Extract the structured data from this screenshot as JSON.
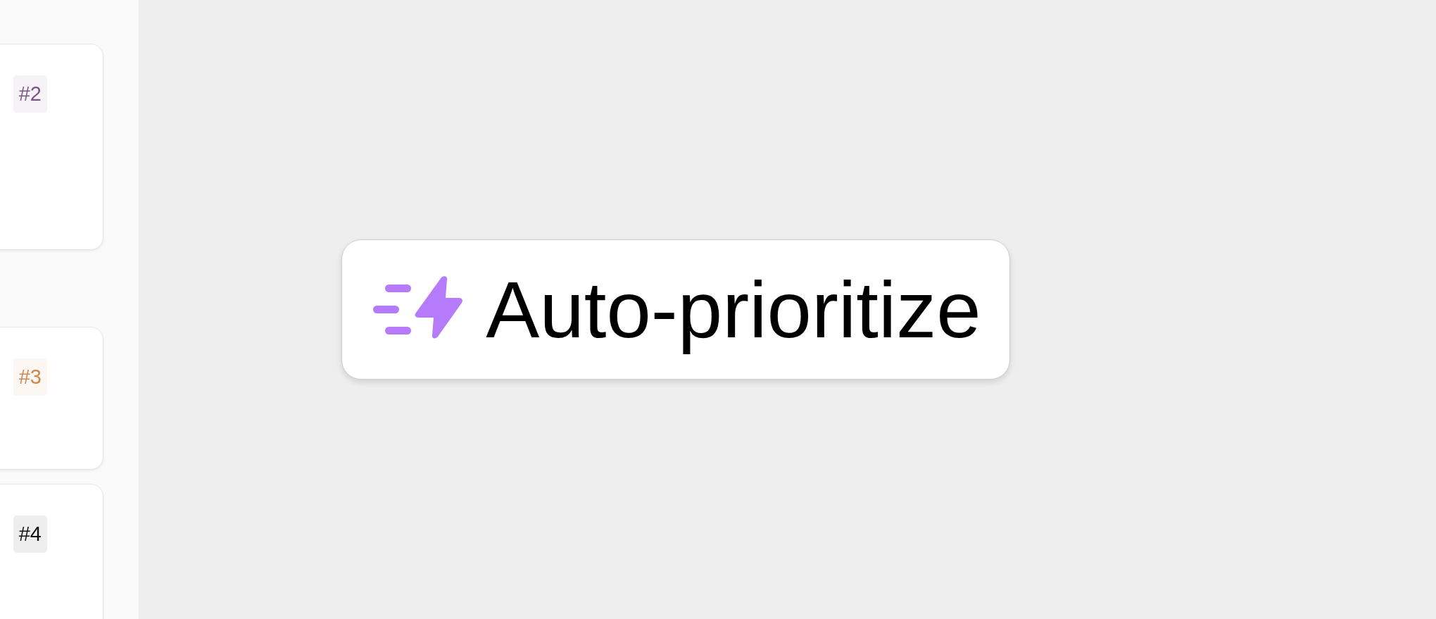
{
  "cards": [
    {
      "badge": "#2",
      "color": "#7e5686"
    },
    {
      "badge": "#3",
      "color": "#d08850"
    },
    {
      "badge": "#4",
      "color": "#111111"
    }
  ],
  "button": {
    "label": "Auto-prioritize"
  }
}
